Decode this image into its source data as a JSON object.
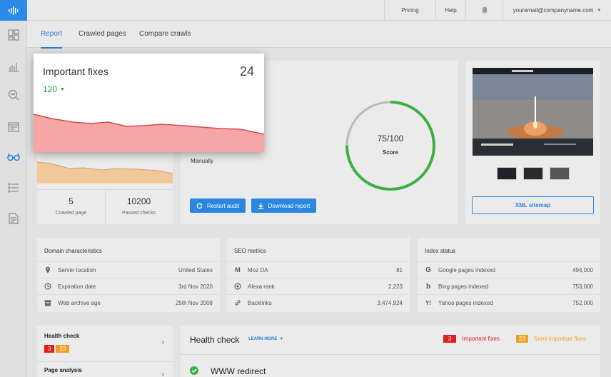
{
  "topbar": {
    "pricing": "Pricing",
    "help": "Help",
    "email": "youremail@companyname.com"
  },
  "tabs": [
    "Report",
    "Crawled pages",
    "Compare crawls"
  ],
  "summary": {
    "crawled_value": "5",
    "crawled_label": "Crawled page",
    "passed_value": "10200",
    "passed_label": "Passed checks"
  },
  "audit": {
    "mode": "Manually",
    "restart_label": "Restart audit",
    "download_label": "Download report",
    "score_value": "75/100",
    "score_label": "Score",
    "score_fraction": 0.75
  },
  "preview": {
    "sitemap_label": "XML sitemap"
  },
  "domain": {
    "title": "Domain characteristics",
    "rows": [
      {
        "icon": "location-pin-icon",
        "label": "Server location",
        "value": "United States"
      },
      {
        "icon": "clock-icon",
        "label": "Expiration date",
        "value": "3rd Nov 2020"
      },
      {
        "icon": "archive-icon",
        "label": "Web archive age",
        "value": "25th Nov 2008"
      }
    ]
  },
  "seo": {
    "title": "SEO metrics",
    "rows": [
      {
        "icon": "moz-icon",
        "label": "Moz DA",
        "value": "81"
      },
      {
        "icon": "alexa-icon",
        "label": "Alexa rank",
        "value": "2,223"
      },
      {
        "icon": "link-icon",
        "label": "Backlinks",
        "value": "3,474,924"
      }
    ]
  },
  "index": {
    "title": "Index status",
    "rows": [
      {
        "icon": "google-icon",
        "label": "Google pages indexed",
        "value": "494,000"
      },
      {
        "icon": "bing-icon",
        "label": "Bing pages indexed",
        "value": "753,000"
      },
      {
        "icon": "yahoo-icon",
        "label": "Yahoo pages indexed",
        "value": "752,000"
      }
    ]
  },
  "left_nav": {
    "health_check": "Health check",
    "health_red": "3",
    "health_orange": "23",
    "page_analysis": "Page analysis"
  },
  "health": {
    "title": "Health check",
    "learn_more": "LEARN MORE",
    "important_count": "3",
    "important_label": "Important fixes",
    "semi_count": "23",
    "semi_label": "Semi-important fixes",
    "first_item": "WWW redirect"
  },
  "popup": {
    "title": "Important fixes",
    "count": "24",
    "delta": "120"
  },
  "colors": {
    "accent": "#2a86e0",
    "score_green": "#3cb043",
    "danger": "#e02020",
    "warning": "#f0a020",
    "delta_green": "#2e9a3a"
  }
}
